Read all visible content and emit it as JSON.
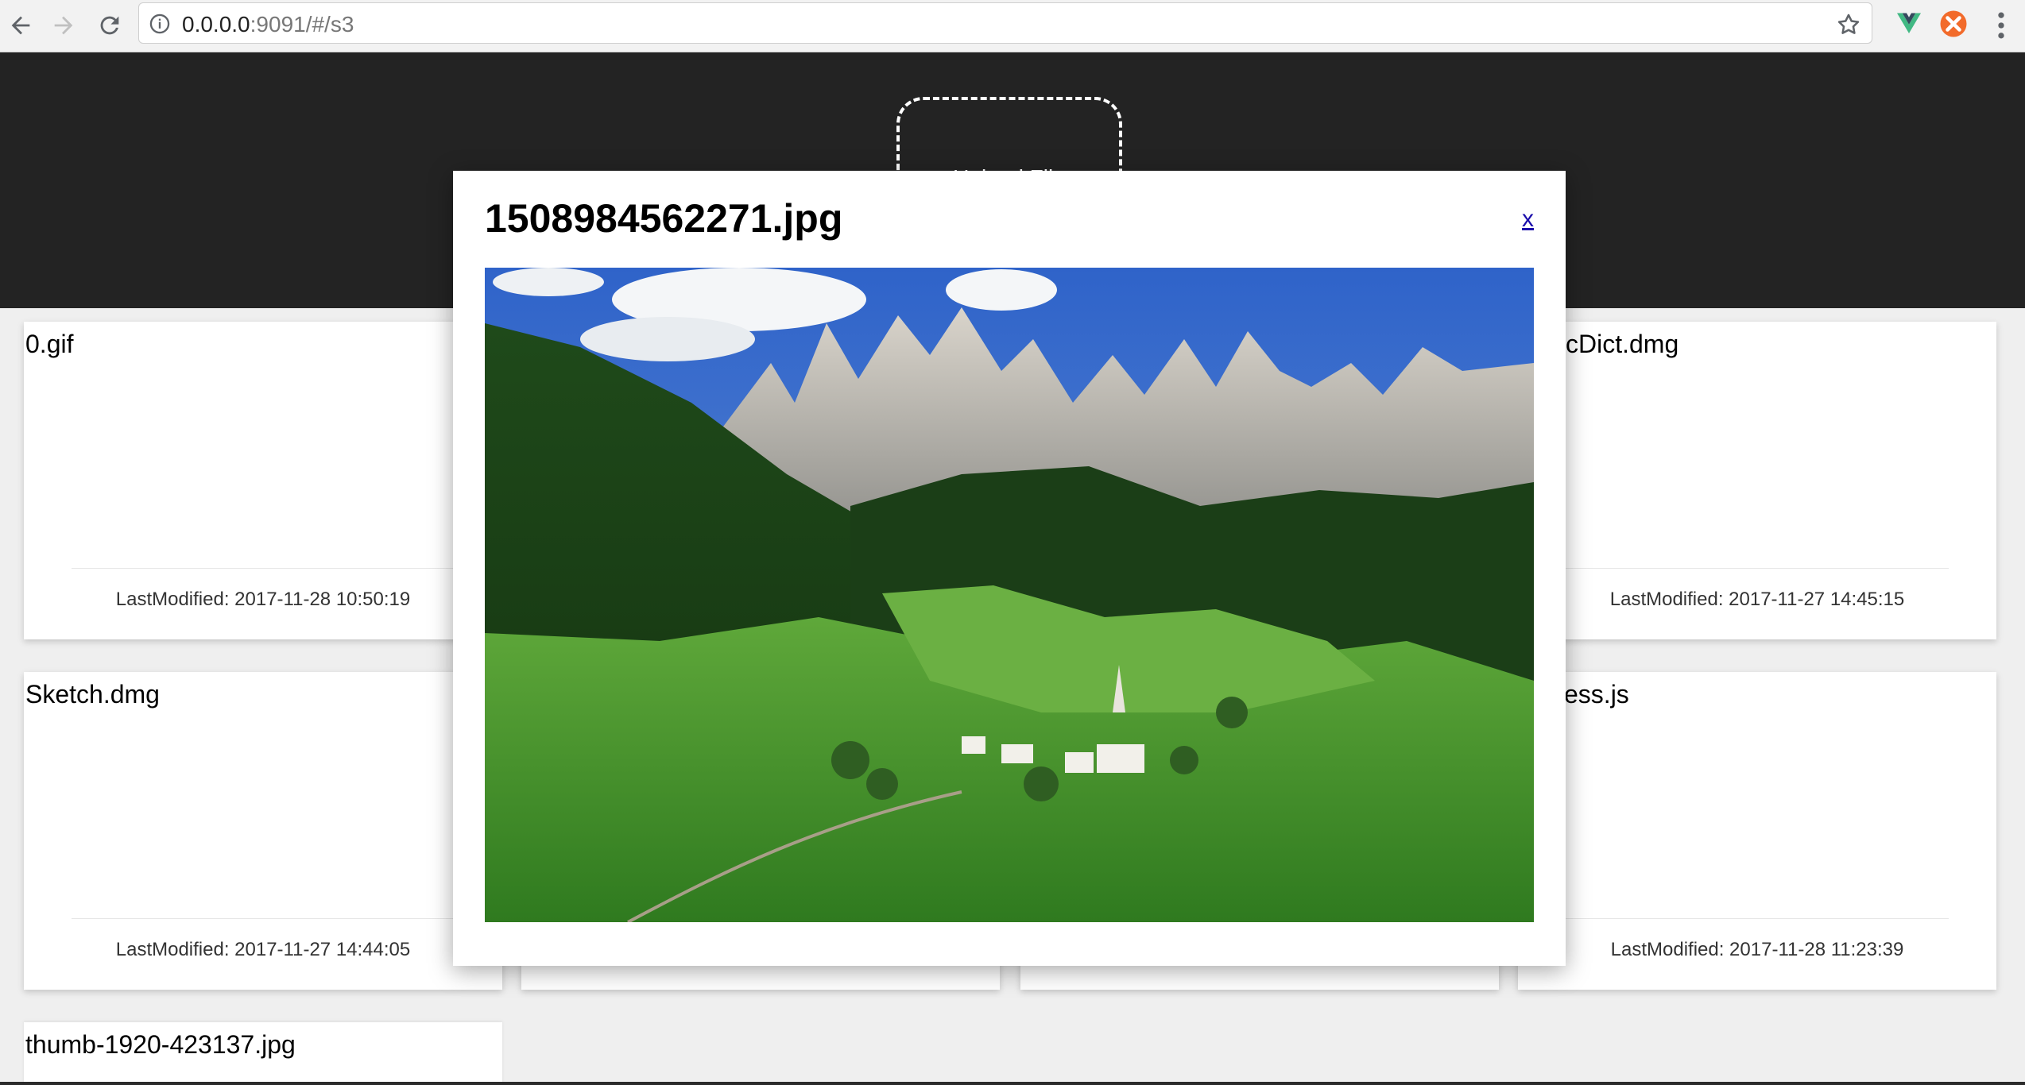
{
  "browser": {
    "url_host": "0.0.0.0",
    "url_path": ":9091/#/s3",
    "icons": {
      "back": "arrow-left-icon",
      "forward": "arrow-right-icon",
      "reload": "reload-icon",
      "info": "info-circle-icon",
      "bookmark": "star-icon",
      "vue_devtools": "vue-logo-icon",
      "extension": "orange-extension-icon",
      "menu": "kebab-menu-icon"
    }
  },
  "header": {
    "upload_label": "Upload File"
  },
  "cards": [
    {
      "title": "0.gif",
      "footer": "LastModified: 2017-11-28 10:50:19"
    },
    {
      "title": "",
      "footer": ""
    },
    {
      "title": "",
      "footer": ""
    },
    {
      "title": "cDict.dmg",
      "footer": "LastModified: 2017-11-27 14:45:15"
    },
    {
      "title": "Sketch.dmg",
      "footer": "LastModified: 2017-11-27 14:44:05"
    },
    {
      "title": "",
      "footer": ""
    },
    {
      "title": "",
      "footer": ""
    },
    {
      "title": "cess.js",
      "footer": "LastModified: 2017-11-28 11:23:39"
    },
    {
      "title": "thumb-1920-423137.jpg",
      "footer": ""
    }
  ],
  "modal": {
    "title": "1508984562271.jpg",
    "close_label": "x",
    "image_alt": "mountain valley landscape"
  },
  "colors": {
    "header_bg": "#232323",
    "page_bg": "#efefef",
    "link": "#1a0dab"
  }
}
